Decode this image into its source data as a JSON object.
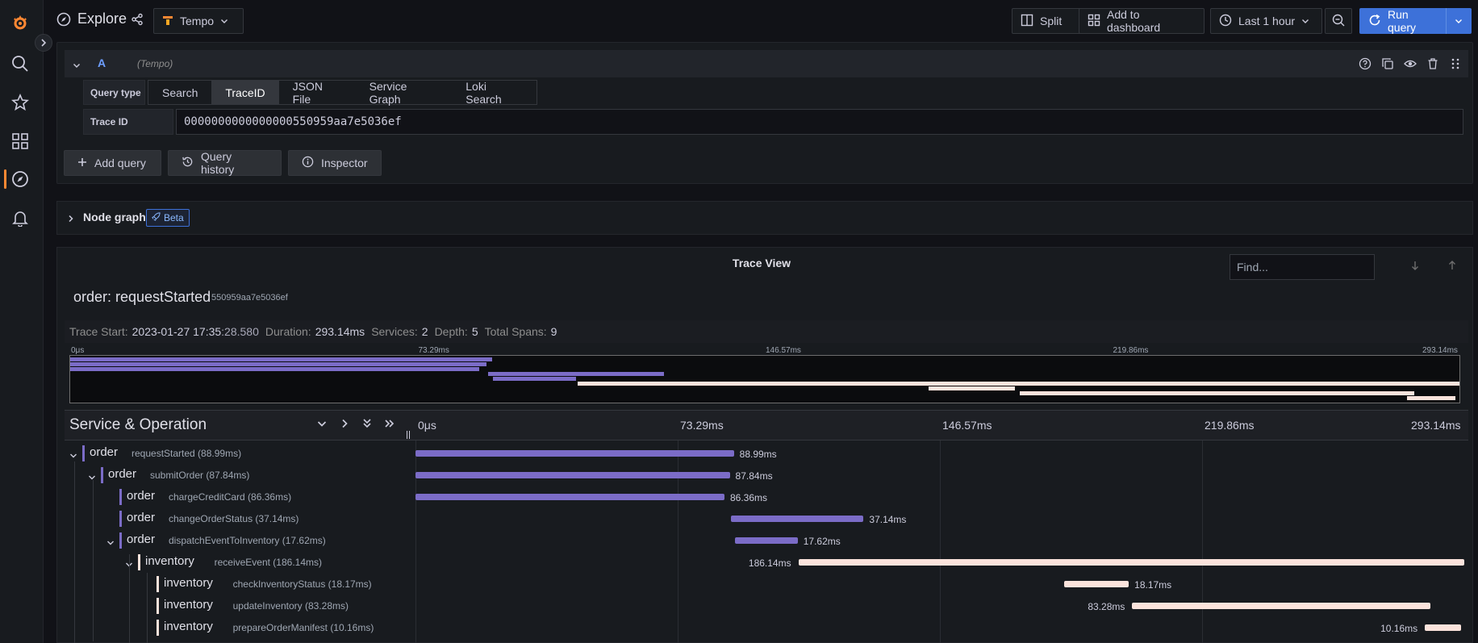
{
  "colors": {
    "accent": "#3d71d9",
    "order": "#7b6cc7",
    "inventory": "#fbe3dc",
    "logo": "#ff8833"
  },
  "topbar": {
    "title": "Explore",
    "datasource": "Tempo",
    "split_label": "Split",
    "add_to_dashboard_label": "Add to dashboard",
    "time_range": "Last 1 hour",
    "run_query_label": "Run query"
  },
  "query": {
    "ref_id": "A",
    "datasource_hint": "(Tempo)",
    "query_type_label": "Query type",
    "query_types": [
      "Search",
      "TraceID",
      "JSON File",
      "Service Graph",
      "Loki Search"
    ],
    "active_query_type": "TraceID",
    "trace_id_label": "Trace ID",
    "trace_id_value": "0000000000000000550959aa7e5036ef",
    "add_query_label": "Add query",
    "query_history_label": "Query history",
    "inspector_label": "Inspector"
  },
  "node_graph": {
    "label": "Node graph",
    "badge": "Beta"
  },
  "trace": {
    "panel_title": "Trace View",
    "find_placeholder": "Find...",
    "title": "order: requestStarted",
    "trace_id_short": "550959aa7e5036ef",
    "stats": {
      "start_label": "Trace Start:",
      "start_date": "2023-01-27 17:35",
      "start_ms": ":28.580",
      "duration_label": "Duration:",
      "duration": "293.14ms",
      "services_label": "Services:",
      "services": "2",
      "depth_label": "Depth:",
      "depth": "5",
      "spans_label": "Total Spans:",
      "spans": "9"
    },
    "minimap_ticks": [
      "0μs",
      "73.29ms",
      "146.57ms",
      "219.86ms",
      "293.14ms"
    ],
    "header_title": "Service & Operation",
    "timeline_ticks": [
      "0μs",
      "73.29ms",
      "146.57ms",
      "219.86ms",
      "293.14ms"
    ],
    "spans": [
      {
        "service": "order",
        "operation": "requestStarted (88.99ms)",
        "duration_label": "88.99ms",
        "start": 0,
        "duration": 88.99,
        "depth": 0,
        "expandable": true
      },
      {
        "service": "order",
        "operation": "submitOrder (87.84ms)",
        "duration_label": "87.84ms",
        "start": 0,
        "duration": 87.84,
        "depth": 1,
        "expandable": true
      },
      {
        "service": "order",
        "operation": "chargeCreditCard (86.36ms)",
        "duration_label": "86.36ms",
        "start": 0,
        "duration": 86.36,
        "depth": 2,
        "expandable": false
      },
      {
        "service": "order",
        "operation": "changeOrderStatus (37.14ms)",
        "duration_label": "37.14ms",
        "start": 88.1,
        "duration": 37.14,
        "depth": 2,
        "expandable": false
      },
      {
        "service": "order",
        "operation": "dispatchEventToInventory (17.62ms)",
        "duration_label": "17.62ms",
        "start": 89.2,
        "duration": 17.62,
        "depth": 2,
        "expandable": true
      },
      {
        "service": "inventory",
        "operation": "receiveEvent (186.14ms)",
        "duration_label": "186.14ms",
        "start": 107.0,
        "duration": 186.14,
        "depth": 3,
        "expandable": true
      },
      {
        "service": "inventory",
        "operation": "checkInventoryStatus (18.17ms)",
        "duration_label": "18.17ms",
        "start": 181.2,
        "duration": 18.17,
        "depth": 4,
        "expandable": false
      },
      {
        "service": "inventory",
        "operation": "updateInventory (83.28ms)",
        "duration_label": "83.28ms",
        "start": 200.3,
        "duration": 83.28,
        "depth": 4,
        "expandable": false
      },
      {
        "service": "inventory",
        "operation": "prepareOrderManifest (10.16ms)",
        "duration_label": "10.16ms",
        "start": 282.1,
        "duration": 10.16,
        "depth": 4,
        "expandable": false
      }
    ]
  }
}
